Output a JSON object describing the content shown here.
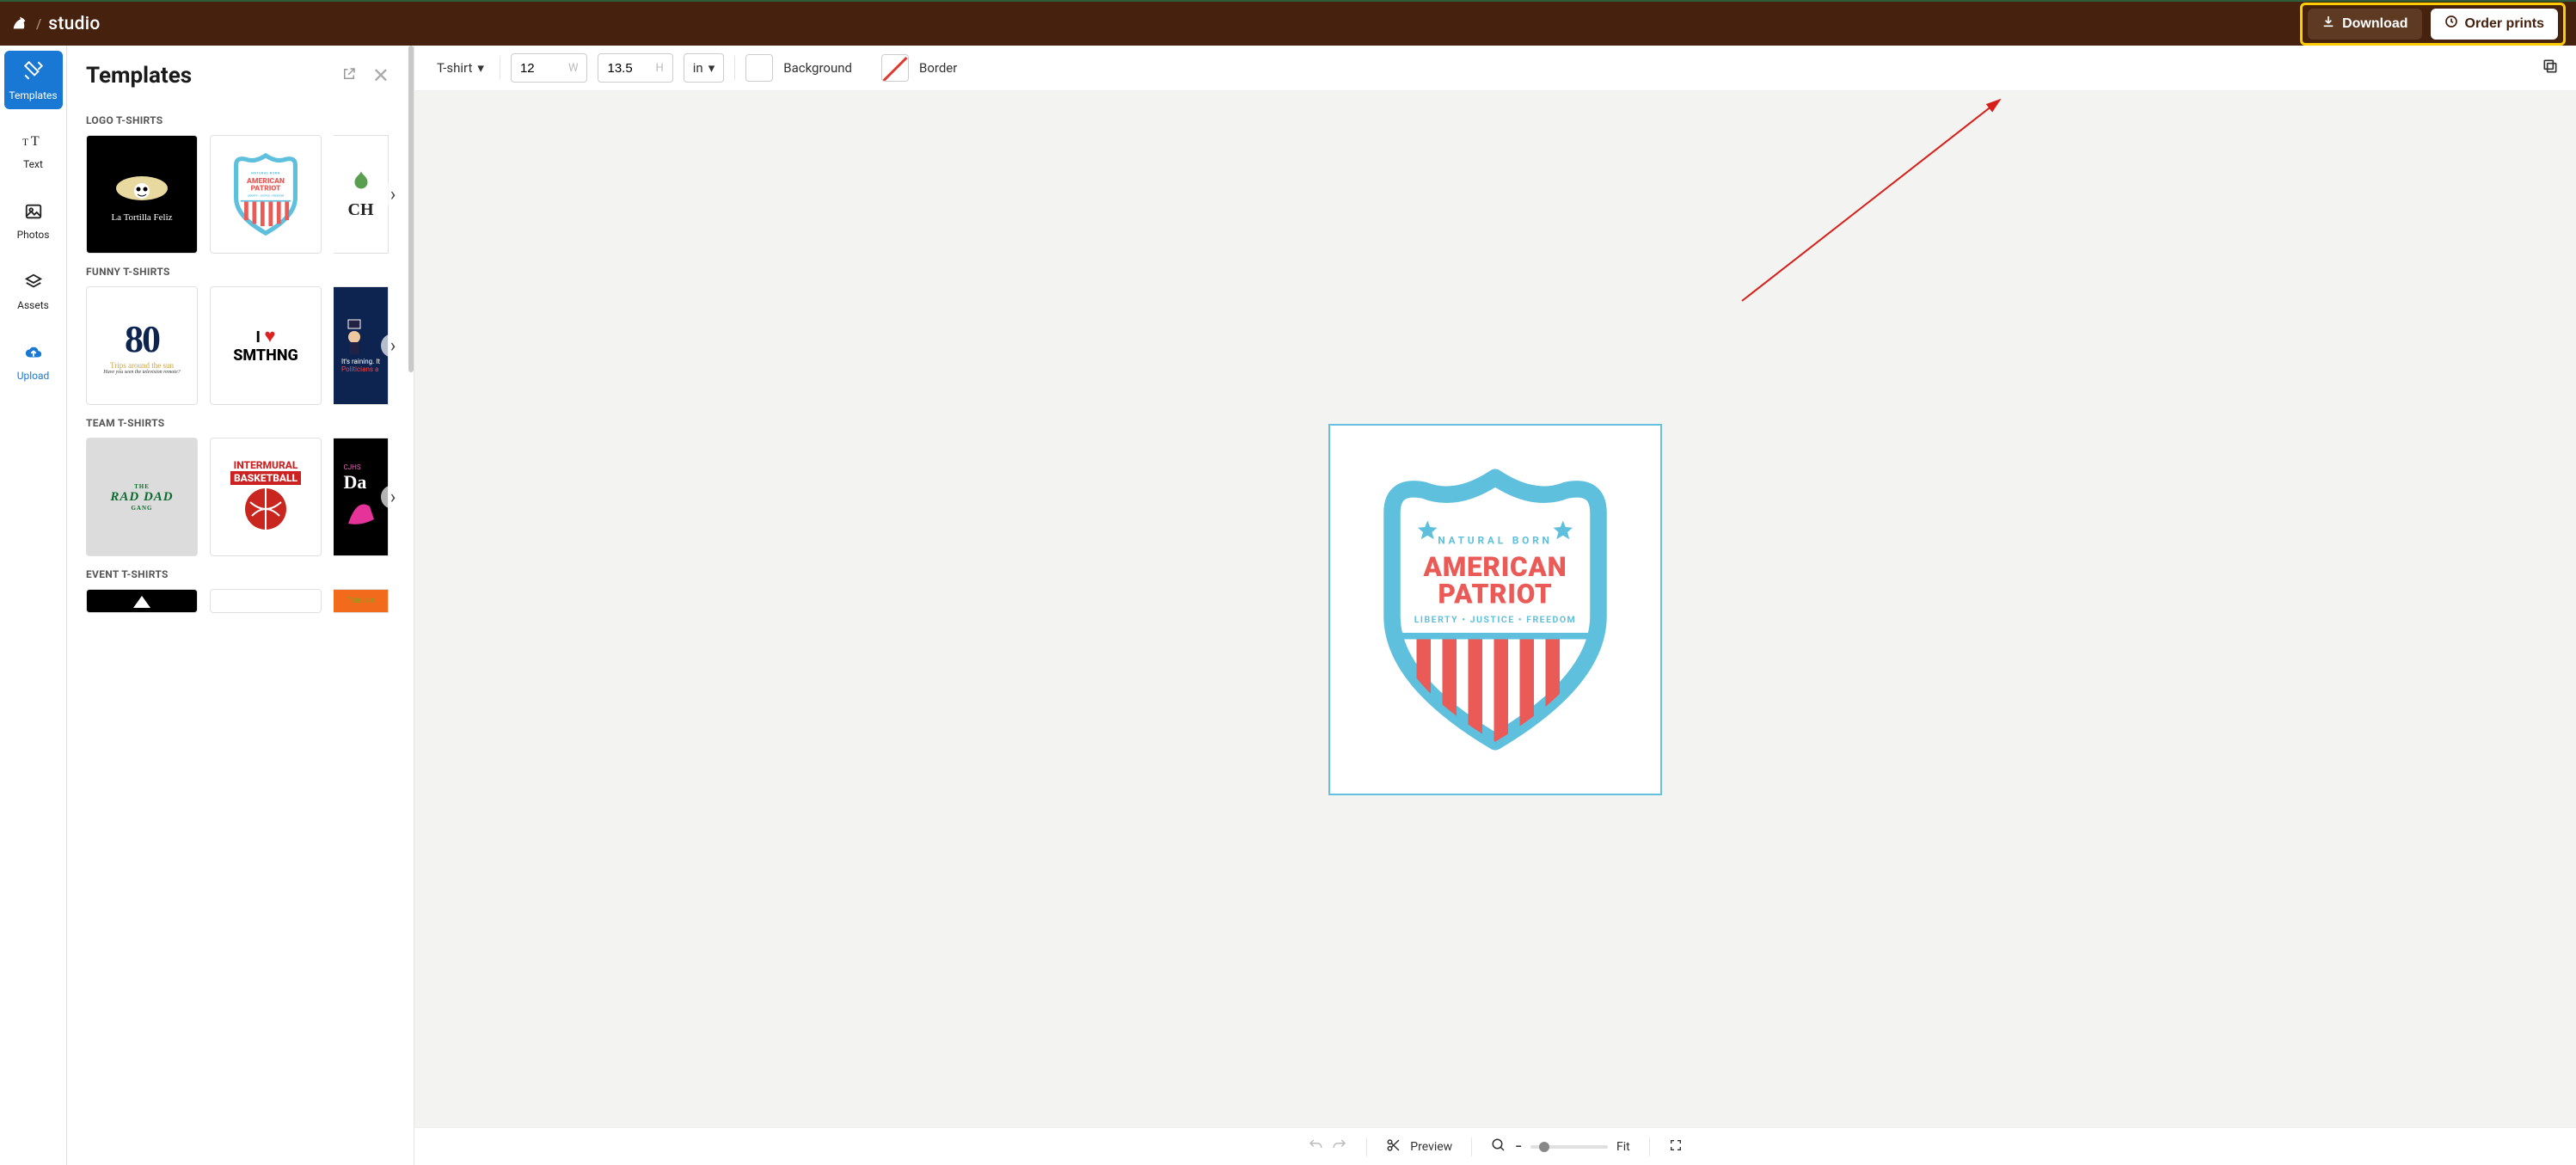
{
  "brand": {
    "name": "studio"
  },
  "header": {
    "download_label": "Download",
    "order_label": "Order prints"
  },
  "rail": {
    "templates": "Templates",
    "text": "Text",
    "photos": "Photos",
    "assets": "Assets",
    "upload": "Upload"
  },
  "panel": {
    "title": "Templates",
    "sections": {
      "logo": "LOGO T-SHIRTS",
      "funny": "FUNNY T-SHIRTS",
      "team": "TEAM T-SHIRTS",
      "event": "EVENT T-SHIRTS"
    },
    "thumbs": {
      "tortilla": "La Tortilla Feliz",
      "patriot_top": "NATURAL BORN",
      "patriot_main1": "AMERICAN",
      "patriot_main2": "PATRIOT",
      "patriot_sub": "LIBERTY • JUSTICE • FREEDOM",
      "ch": "CH",
      "eighty": "80",
      "eighty_sub": "Trips around the sun",
      "eighty_tiny": "Have you seen the television remote?",
      "ismth_1": "I ",
      "ismth_2": "SMTHNG",
      "rain1": "It's raining. It",
      "rain2": "Politicians a",
      "rad_top": "THE",
      "rad_main": "RAD DAD",
      "rad_sub": "GANG",
      "imb1": "INTERMURAL",
      "imb2": "BASKETBALL",
      "cjhs": "CJHS",
      "cjhs2": "Da",
      "thisis": "This is n"
    }
  },
  "toolbar": {
    "product": "T-shirt",
    "width": "12",
    "height": "13.5",
    "w_hint": "W",
    "h_hint": "H",
    "unit": "in",
    "background": "Background",
    "border": "Border"
  },
  "design": {
    "topline": "NATURAL BORN",
    "line1": "AMERICAN",
    "line2": "PATRIOT",
    "subline": "LIBERTY • JUSTICE • FREEDOM",
    "colors": {
      "blue": "#5fc0dd",
      "red": "#ea5a56",
      "white": "#ffffff"
    }
  },
  "bottombar": {
    "preview": "Preview",
    "fit": "Fit"
  }
}
